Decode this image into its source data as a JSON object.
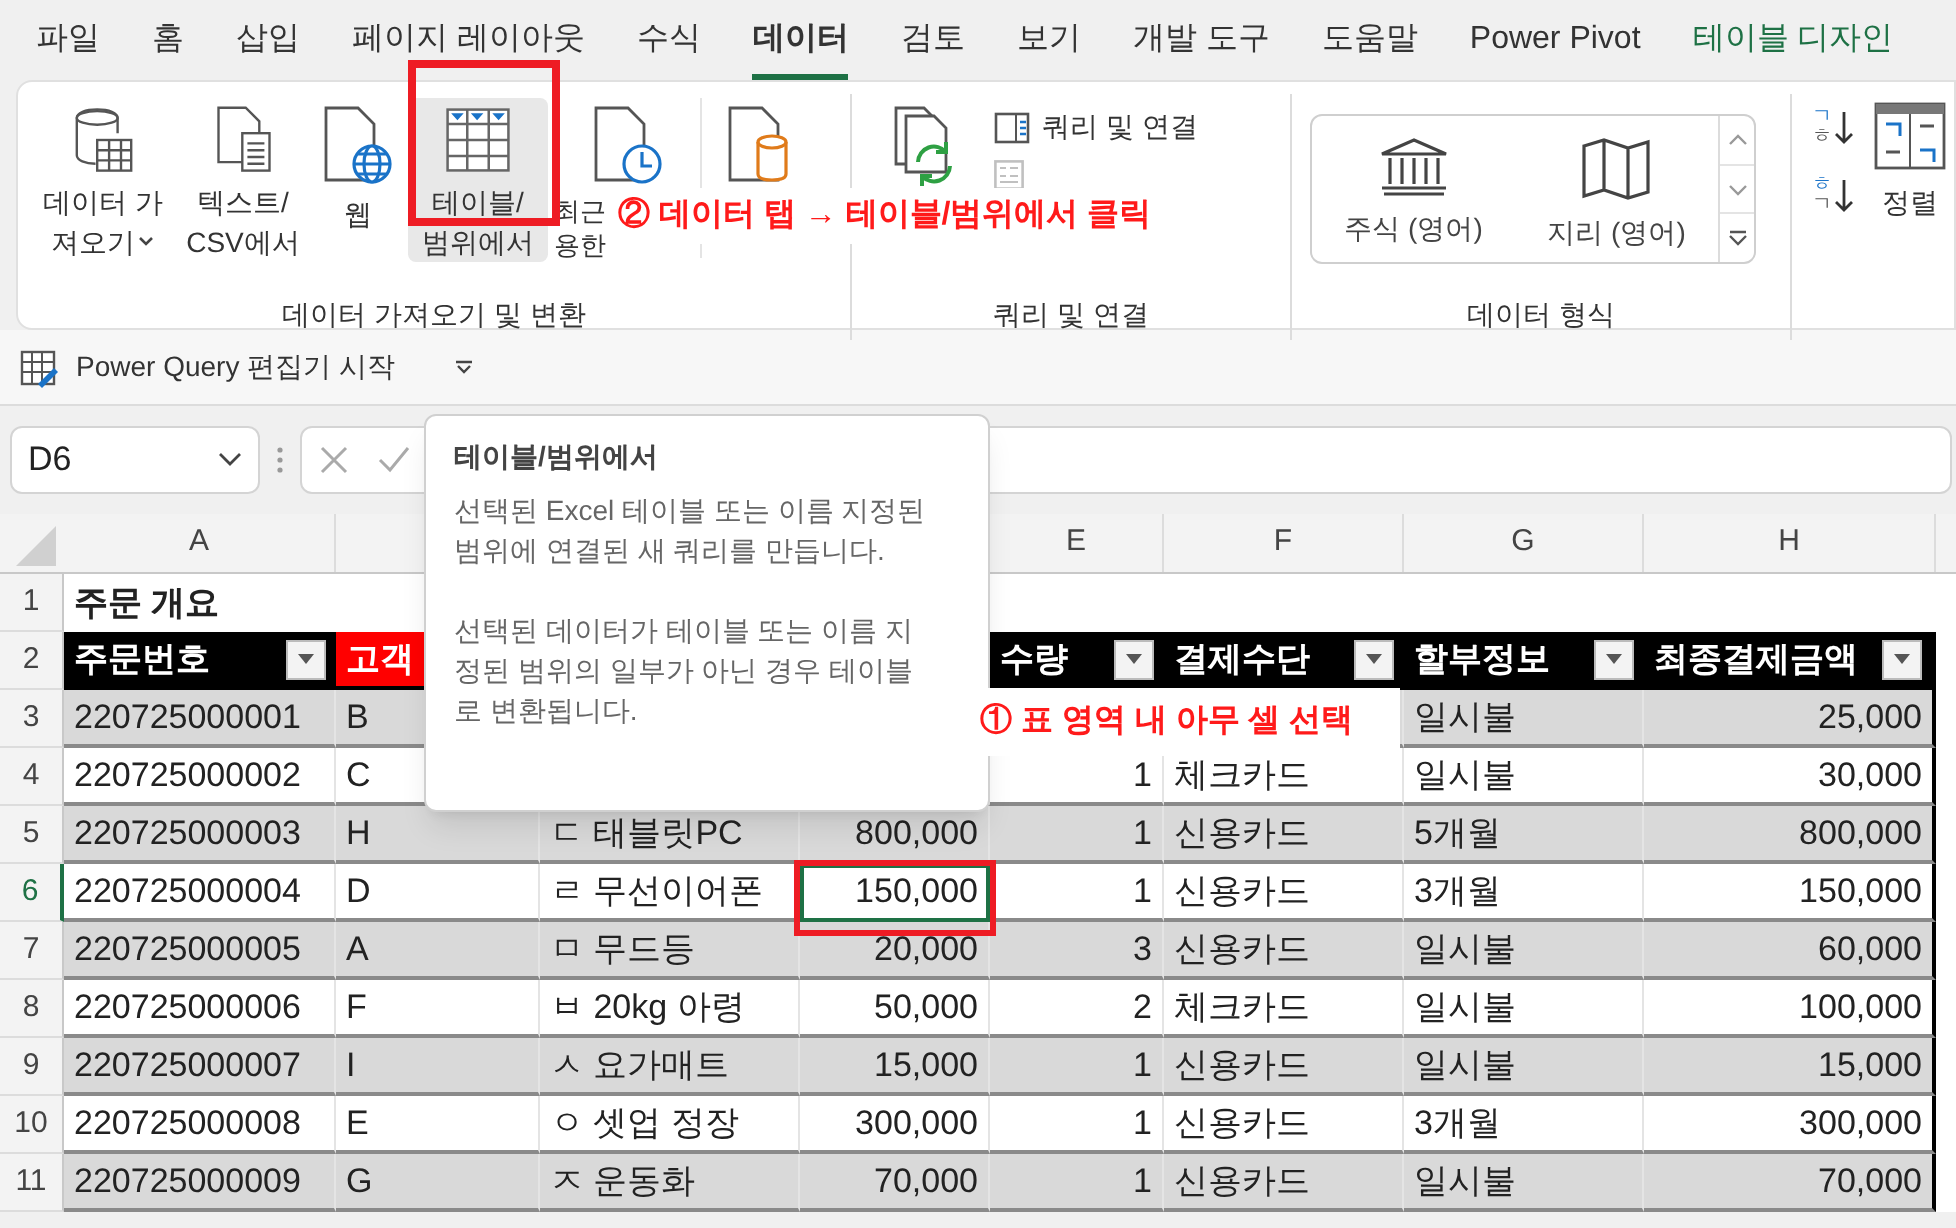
{
  "tabs": [
    {
      "label": "파일",
      "selected": false,
      "kind": "normal"
    },
    {
      "label": "홈",
      "selected": false,
      "kind": "normal"
    },
    {
      "label": "삽입",
      "selected": false,
      "kind": "normal"
    },
    {
      "label": "페이지 레이아웃",
      "selected": false,
      "kind": "normal"
    },
    {
      "label": "수식",
      "selected": false,
      "kind": "normal"
    },
    {
      "label": "데이터",
      "selected": true,
      "kind": "normal"
    },
    {
      "label": "검토",
      "selected": false,
      "kind": "normal"
    },
    {
      "label": "보기",
      "selected": false,
      "kind": "normal"
    },
    {
      "label": "개발 도구",
      "selected": false,
      "kind": "normal"
    },
    {
      "label": "도움말",
      "selected": false,
      "kind": "normal"
    },
    {
      "label": "Power Pivot",
      "selected": false,
      "kind": "normal"
    },
    {
      "label": "테이블 디자인",
      "selected": false,
      "kind": "contextual"
    }
  ],
  "ribbon": {
    "groups": [
      {
        "label": "데이터 가져오기 및 변환",
        "buttons": [
          {
            "lines": [
              "데이터 가",
              "져오기"
            ],
            "dropdown": true,
            "highlighted": false
          },
          {
            "lines": [
              "텍스트/",
              "CSV에서"
            ],
            "highlighted": false
          },
          {
            "lines": [
              "웹"
            ],
            "highlighted": false
          },
          {
            "lines": [
              "테이블/",
              "범위에서"
            ],
            "highlighted": true
          },
          {
            "lines": [
              "최근",
              "용한"
            ],
            "highlighted": false
          },
          {
            "highlighted": false
          }
        ]
      },
      {
        "label": "쿼리 및 연결",
        "small_buttons": [
          {
            "label": "쿼리 및 연결",
            "disabled": false
          },
          {
            "disabled": true
          }
        ]
      },
      {
        "label": "데이터 형식",
        "gallery": [
          "주식 (영어)",
          "지리 (영어)"
        ]
      },
      {
        "sort_buttons": [
          {
            "top": "ㄱ",
            "bottom": "ㅎ"
          },
          {
            "top": "ㅎ",
            "bottom": "ㄱ"
          }
        ],
        "sort_label": "정렬"
      }
    ]
  },
  "power_query": {
    "label": "Power Query 편집기 시작"
  },
  "formula_bar": {
    "name_box": "D6"
  },
  "tooltip": {
    "title": "테이블/범위에서",
    "paragraphs": [
      "선택된 Excel 테이블 또는 이름 지정된 범위에 연결된 새 쿼리를 만듭니다.",
      "선택된 데이터가 테이블 또는 이름 지정된 범위의 일부가 아닌 경우 테이블로 변환됩니다."
    ]
  },
  "annotations": [
    {
      "text": "② 데이터 탭 → 테이블/범위에서 클릭"
    },
    {
      "text": "① 표 영역 내 아무 셀 선택"
    }
  ],
  "sheet": {
    "columns": [
      {
        "letter": "A"
      },
      {},
      {},
      {},
      {
        "letter": "E"
      },
      {
        "letter": "F"
      },
      {
        "letter": "G"
      },
      {
        "letter": "H"
      }
    ],
    "rows": [
      {
        "num": "1",
        "kind": "title",
        "selected": false,
        "cells": {
          "A": "주문 개요"
        }
      },
      {
        "num": "2",
        "kind": "header",
        "selected": false,
        "cells": {
          "A": {
            "text": "주문번호",
            "color": "#000000",
            "filter": true
          },
          "B": {
            "text": "고객",
            "color": "#ff0000"
          },
          "E": {
            "text": "수량",
            "color": "#000000",
            "filter": true
          },
          "F": {
            "text": "결제수단",
            "color": "#000000",
            "filter": true
          },
          "G": {
            "text": "할부정보",
            "color": "#000000",
            "filter": true
          },
          "H": {
            "text": "최종결제금액",
            "color": "#000000",
            "filter": true
          }
        }
      },
      {
        "num": "3",
        "kind": "data",
        "selected": false,
        "cells": {
          "A": "220725000001",
          "B": "B",
          "G": "일시불",
          "H": "25,000"
        }
      },
      {
        "num": "4",
        "kind": "data",
        "selected": false,
        "cells": {
          "A": "220725000002",
          "B": "C",
          "E": "1",
          "F": "체크카드",
          "G": "일시불",
          "H": "30,000"
        }
      },
      {
        "num": "5",
        "kind": "data",
        "selected": false,
        "cells": {
          "A": "220725000003",
          "B": "H",
          "C": "ㄷ 태블릿PC",
          "D": "800,000",
          "E": "1",
          "F": "신용카드",
          "G": "5개월",
          "H": "800,000"
        }
      },
      {
        "num": "6",
        "kind": "data",
        "selected": true,
        "cells": {
          "A": "220725000004",
          "B": "D",
          "C": "ㄹ 무선이어폰",
          "D": {
            "text": "150,000",
            "selected": true
          },
          "E": "1",
          "F": "신용카드",
          "G": "3개월",
          "H": "150,000"
        }
      },
      {
        "num": "7",
        "kind": "data",
        "selected": false,
        "cells": {
          "A": "220725000005",
          "B": "A",
          "C": "ㅁ 무드등",
          "D": "20,000",
          "E": "3",
          "F": "신용카드",
          "G": "일시불",
          "H": "60,000"
        }
      },
      {
        "num": "8",
        "kind": "data",
        "selected": false,
        "cells": {
          "A": "220725000006",
          "B": "F",
          "C": "ㅂ 20kg 아령",
          "D": "50,000",
          "E": "2",
          "F": "체크카드",
          "G": "일시불",
          "H": "100,000"
        }
      },
      {
        "num": "9",
        "kind": "data",
        "selected": false,
        "cells": {
          "A": "220725000007",
          "B": "I",
          "C": "ㅅ 요가매트",
          "D": "15,000",
          "E": "1",
          "F": "신용카드",
          "G": "일시불",
          "H": "15,000"
        }
      },
      {
        "num": "10",
        "kind": "data",
        "selected": false,
        "cells": {
          "A": "220725000008",
          "B": "E",
          "C": "ㅇ 셋업 정장",
          "D": "300,000",
          "E": "1",
          "F": "신용카드",
          "G": "3개월",
          "H": "300,000"
        }
      },
      {
        "num": "11",
        "kind": "data",
        "selected": false,
        "cells": {
          "A": "220725000009",
          "B": "G",
          "C": "ㅈ 운동화",
          "D": "70,000",
          "E": "1",
          "F": "신용카드",
          "G": "일시불",
          "H": "70,000"
        }
      }
    ]
  }
}
